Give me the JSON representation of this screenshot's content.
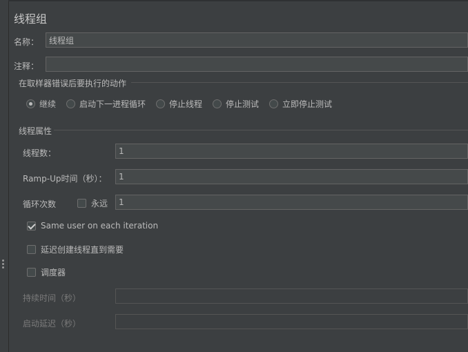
{
  "panel": {
    "title": "线程组"
  },
  "name": {
    "label": "名称：",
    "value": "线程组"
  },
  "comment": {
    "label": "注释：",
    "value": ""
  },
  "error_action": {
    "heading": "在取样器错误后要执行的动作",
    "options": [
      {
        "label": "继续",
        "selected": true
      },
      {
        "label": "启动下一进程循环",
        "selected": false
      },
      {
        "label": "停止线程",
        "selected": false
      },
      {
        "label": "停止测试",
        "selected": false
      },
      {
        "label": "立即停止测试",
        "selected": false
      }
    ]
  },
  "thread_props": {
    "heading": "线程属性",
    "threads": {
      "label": "线程数：",
      "value": "1"
    },
    "rampup": {
      "label": "Ramp-Up时间（秒）：",
      "value": "1"
    },
    "loop": {
      "label": "循环次数",
      "forever_label": "永远",
      "forever_checked": false,
      "value": "1"
    },
    "same_user": {
      "label": "Same user on each iteration",
      "checked": true
    },
    "delay_create": {
      "label": "延迟创建线程直到需要",
      "checked": false
    },
    "scheduler": {
      "label": "调度器",
      "checked": false
    },
    "duration": {
      "label": "持续时间（秒）",
      "value": ""
    },
    "startup_delay": {
      "label": "启动延迟（秒）",
      "value": ""
    }
  }
}
